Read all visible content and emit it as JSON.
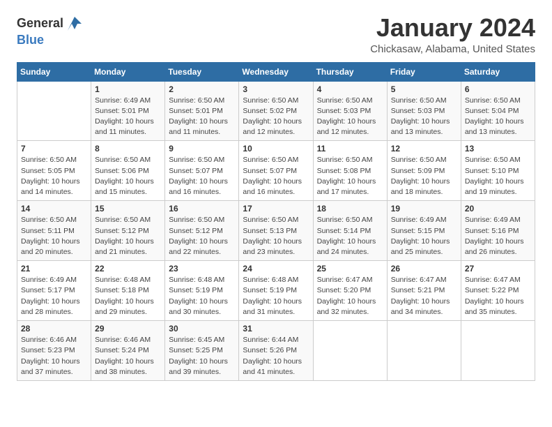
{
  "header": {
    "logo_general": "General",
    "logo_blue": "Blue",
    "month_title": "January 2024",
    "location": "Chickasaw, Alabama, United States"
  },
  "calendar": {
    "days_of_week": [
      "Sunday",
      "Monday",
      "Tuesday",
      "Wednesday",
      "Thursday",
      "Friday",
      "Saturday"
    ],
    "weeks": [
      [
        {
          "day": "",
          "info": ""
        },
        {
          "day": "1",
          "info": "Sunrise: 6:49 AM\nSunset: 5:01 PM\nDaylight: 10 hours\nand 11 minutes."
        },
        {
          "day": "2",
          "info": "Sunrise: 6:50 AM\nSunset: 5:01 PM\nDaylight: 10 hours\nand 11 minutes."
        },
        {
          "day": "3",
          "info": "Sunrise: 6:50 AM\nSunset: 5:02 PM\nDaylight: 10 hours\nand 12 minutes."
        },
        {
          "day": "4",
          "info": "Sunrise: 6:50 AM\nSunset: 5:03 PM\nDaylight: 10 hours\nand 12 minutes."
        },
        {
          "day": "5",
          "info": "Sunrise: 6:50 AM\nSunset: 5:03 PM\nDaylight: 10 hours\nand 13 minutes."
        },
        {
          "day": "6",
          "info": "Sunrise: 6:50 AM\nSunset: 5:04 PM\nDaylight: 10 hours\nand 13 minutes."
        }
      ],
      [
        {
          "day": "7",
          "info": "Sunrise: 6:50 AM\nSunset: 5:05 PM\nDaylight: 10 hours\nand 14 minutes."
        },
        {
          "day": "8",
          "info": "Sunrise: 6:50 AM\nSunset: 5:06 PM\nDaylight: 10 hours\nand 15 minutes."
        },
        {
          "day": "9",
          "info": "Sunrise: 6:50 AM\nSunset: 5:07 PM\nDaylight: 10 hours\nand 16 minutes."
        },
        {
          "day": "10",
          "info": "Sunrise: 6:50 AM\nSunset: 5:07 PM\nDaylight: 10 hours\nand 16 minutes."
        },
        {
          "day": "11",
          "info": "Sunrise: 6:50 AM\nSunset: 5:08 PM\nDaylight: 10 hours\nand 17 minutes."
        },
        {
          "day": "12",
          "info": "Sunrise: 6:50 AM\nSunset: 5:09 PM\nDaylight: 10 hours\nand 18 minutes."
        },
        {
          "day": "13",
          "info": "Sunrise: 6:50 AM\nSunset: 5:10 PM\nDaylight: 10 hours\nand 19 minutes."
        }
      ],
      [
        {
          "day": "14",
          "info": "Sunrise: 6:50 AM\nSunset: 5:11 PM\nDaylight: 10 hours\nand 20 minutes."
        },
        {
          "day": "15",
          "info": "Sunrise: 6:50 AM\nSunset: 5:12 PM\nDaylight: 10 hours\nand 21 minutes."
        },
        {
          "day": "16",
          "info": "Sunrise: 6:50 AM\nSunset: 5:12 PM\nDaylight: 10 hours\nand 22 minutes."
        },
        {
          "day": "17",
          "info": "Sunrise: 6:50 AM\nSunset: 5:13 PM\nDaylight: 10 hours\nand 23 minutes."
        },
        {
          "day": "18",
          "info": "Sunrise: 6:50 AM\nSunset: 5:14 PM\nDaylight: 10 hours\nand 24 minutes."
        },
        {
          "day": "19",
          "info": "Sunrise: 6:49 AM\nSunset: 5:15 PM\nDaylight: 10 hours\nand 25 minutes."
        },
        {
          "day": "20",
          "info": "Sunrise: 6:49 AM\nSunset: 5:16 PM\nDaylight: 10 hours\nand 26 minutes."
        }
      ],
      [
        {
          "day": "21",
          "info": "Sunrise: 6:49 AM\nSunset: 5:17 PM\nDaylight: 10 hours\nand 28 minutes."
        },
        {
          "day": "22",
          "info": "Sunrise: 6:48 AM\nSunset: 5:18 PM\nDaylight: 10 hours\nand 29 minutes."
        },
        {
          "day": "23",
          "info": "Sunrise: 6:48 AM\nSunset: 5:19 PM\nDaylight: 10 hours\nand 30 minutes."
        },
        {
          "day": "24",
          "info": "Sunrise: 6:48 AM\nSunset: 5:19 PM\nDaylight: 10 hours\nand 31 minutes."
        },
        {
          "day": "25",
          "info": "Sunrise: 6:47 AM\nSunset: 5:20 PM\nDaylight: 10 hours\nand 32 minutes."
        },
        {
          "day": "26",
          "info": "Sunrise: 6:47 AM\nSunset: 5:21 PM\nDaylight: 10 hours\nand 34 minutes."
        },
        {
          "day": "27",
          "info": "Sunrise: 6:47 AM\nSunset: 5:22 PM\nDaylight: 10 hours\nand 35 minutes."
        }
      ],
      [
        {
          "day": "28",
          "info": "Sunrise: 6:46 AM\nSunset: 5:23 PM\nDaylight: 10 hours\nand 37 minutes."
        },
        {
          "day": "29",
          "info": "Sunrise: 6:46 AM\nSunset: 5:24 PM\nDaylight: 10 hours\nand 38 minutes."
        },
        {
          "day": "30",
          "info": "Sunrise: 6:45 AM\nSunset: 5:25 PM\nDaylight: 10 hours\nand 39 minutes."
        },
        {
          "day": "31",
          "info": "Sunrise: 6:44 AM\nSunset: 5:26 PM\nDaylight: 10 hours\nand 41 minutes."
        },
        {
          "day": "",
          "info": ""
        },
        {
          "day": "",
          "info": ""
        },
        {
          "day": "",
          "info": ""
        }
      ]
    ]
  }
}
